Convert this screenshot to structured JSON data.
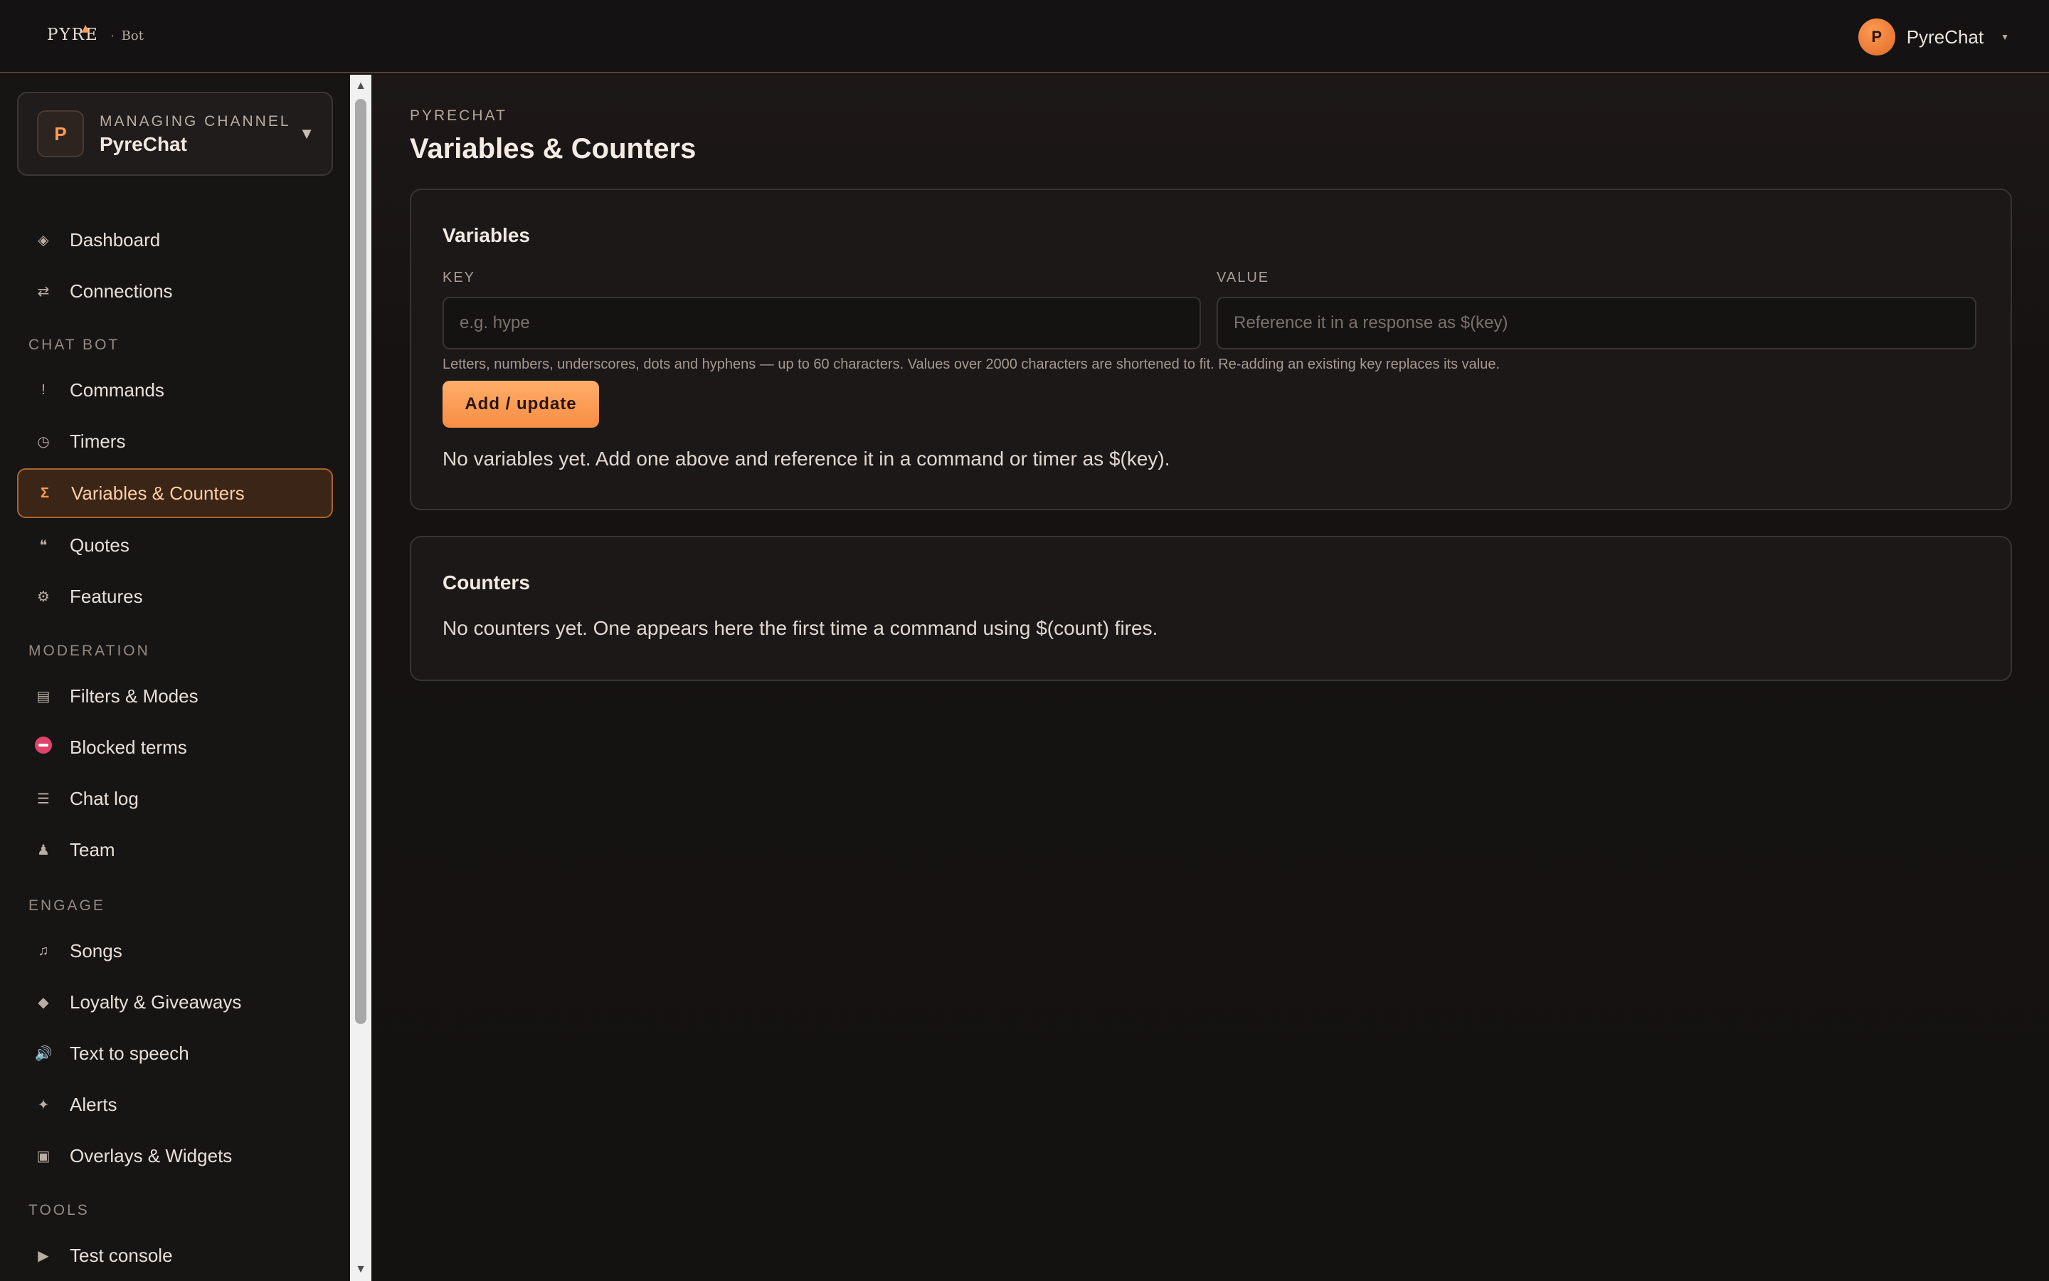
{
  "header": {
    "brand_logo": "PYRE",
    "brand_separator": "·",
    "brand_product": "Bot",
    "user": {
      "initial": "P",
      "name": "PyreChat"
    }
  },
  "sidebar": {
    "channel": {
      "label": "Managing channel",
      "name": "PyreChat",
      "initial": "P"
    },
    "top_items": [
      {
        "label": "Dashboard",
        "icon": "◈"
      },
      {
        "label": "Connections",
        "icon": "⇄"
      }
    ],
    "sections": {
      "chat_bot": "Chat bot",
      "moderation": "Moderation",
      "engage": "Engage",
      "tools": "Tools"
    },
    "chat_bot_items": [
      {
        "label": "Commands",
        "icon": "!"
      },
      {
        "label": "Timers",
        "icon": "◷"
      },
      {
        "label": "Variables & Counters",
        "icon": "Σ",
        "active": true
      },
      {
        "label": "Quotes",
        "icon": "❝"
      },
      {
        "label": "Features",
        "icon": "⚙"
      }
    ],
    "moderation_items": [
      {
        "label": "Filters & Modes",
        "icon": "▤"
      },
      {
        "label": "Blocked terms",
        "icon": "⛔"
      },
      {
        "label": "Chat log",
        "icon": "☰"
      },
      {
        "label": "Team",
        "icon": "♟"
      }
    ],
    "engage_items": [
      {
        "label": "Songs",
        "icon": "♫"
      },
      {
        "label": "Loyalty & Giveaways",
        "icon": "◆"
      },
      {
        "label": "Text to speech",
        "icon": "🔊"
      },
      {
        "label": "Alerts",
        "icon": "✦"
      },
      {
        "label": "Overlays & Widgets",
        "icon": "▣"
      }
    ],
    "tools_items": [
      {
        "label": "Test console",
        "icon": "▶"
      }
    ]
  },
  "main": {
    "breadcrumb": "PyreChat",
    "title": "Variables & Counters",
    "variables": {
      "title": "Variables",
      "key_label": "Key",
      "key_placeholder": "e.g. hype",
      "key_value": "",
      "value_label": "Value",
      "value_placeholder": "Reference it in a response as $(key)",
      "value_value": "",
      "hint": "Letters, numbers, underscores, dots and hyphens — up to 60 characters. Values over 2000 characters are shortened to fit. Re-adding an existing key replaces its value.",
      "submit_label": "Add / update",
      "empty": "No variables yet. Add one above and reference it in a command or timer as $(key)."
    },
    "counters": {
      "title": "Counters",
      "empty": "No counters yet. One appears here the first time a command using $(count) fires."
    }
  },
  "colors": {
    "accent": "#ff9d4d",
    "background": "#141111",
    "card": "#1c1818"
  }
}
